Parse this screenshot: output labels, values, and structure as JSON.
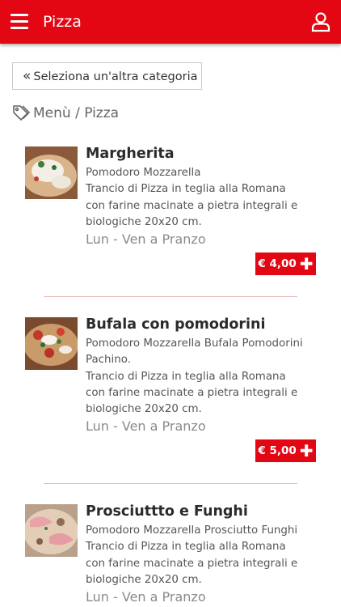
{
  "header": {
    "title": "Pizza"
  },
  "navigation": {
    "category_button_label": "Seleziona un'altra categoria",
    "breadcrumb": "Menù / Pizza"
  },
  "products": [
    {
      "name": "Margherita",
      "description": "Pomodoro Mozzarella\nTrancio di Pizza in teglia alla Romana con farine macinate a pietra integrali e biologiche 20x20 cm.",
      "availability": "Lun - Ven a Pranzo",
      "price": "€ 4,00"
    },
    {
      "name": "Bufala con pomodorini",
      "description": "Pomodoro Mozzarella Bufala Pomodorini Pachino.\nTrancio di Pizza in teglia alla Romana con farine macinate a pietra integrali e biologiche 20x20 cm.",
      "availability": "Lun - Ven a Pranzo",
      "price": "€ 5,00"
    },
    {
      "name": "Prosciuttto e Funghi",
      "description": "Pomodoro Mozzarella Prosciutto Funghi\nTrancio di Pizza in teglia alla Romana con farine macinate a pietra integrali e biologiche 20x20 cm.",
      "availability": "Lun - Ven a Pranzo"
    }
  ],
  "theme": {
    "accent": "#e30613"
  },
  "icons": {
    "menu": "hamburger-icon",
    "user": "user-icon",
    "tag": "tag-icon",
    "back": "double-chevron-left-icon",
    "add": "plus-icon"
  }
}
